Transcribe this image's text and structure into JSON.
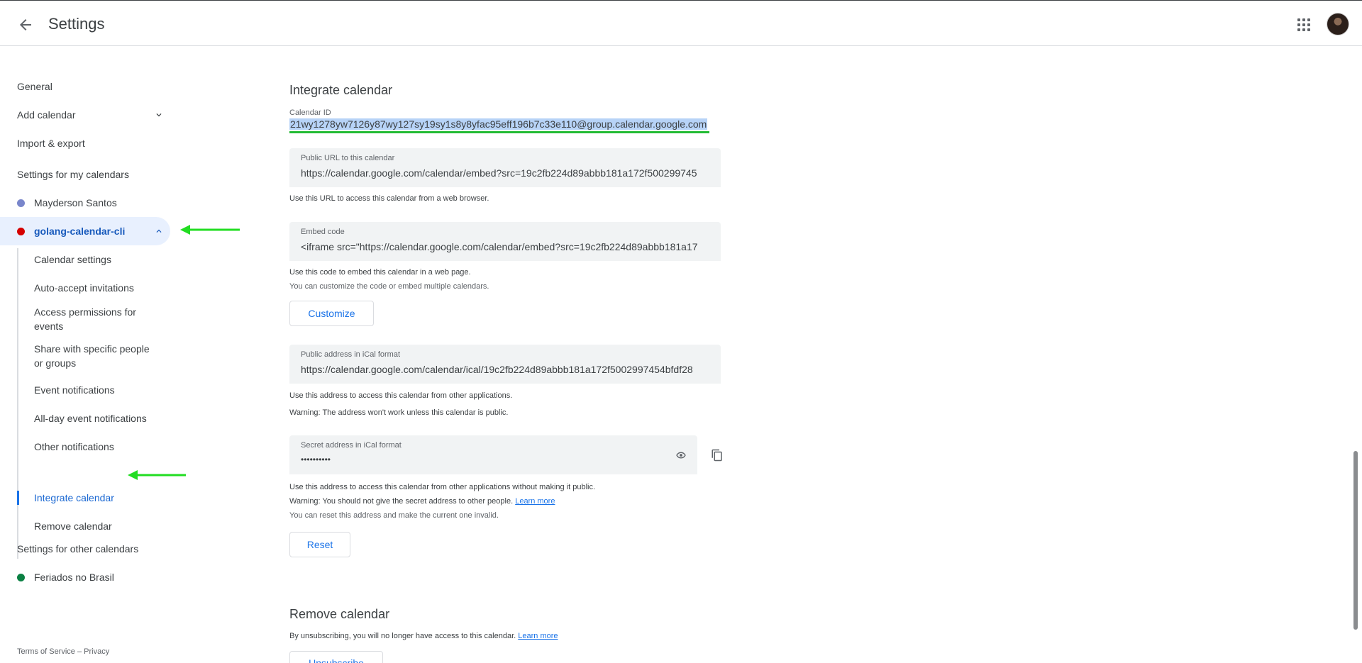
{
  "header": {
    "title": "Settings",
    "back_icon": "arrow-back-icon",
    "apps_icon": "apps-grid-icon"
  },
  "sidebar": {
    "top_items": [
      {
        "label": "General"
      },
      {
        "label": "Add calendar"
      },
      {
        "label": "Import & export"
      }
    ],
    "my_calendars_title": "Settings for my calendars",
    "my_calendars": [
      {
        "label": "Mayderson Santos",
        "color": "#7986cb"
      },
      {
        "label": "golang-calendar-cli",
        "color": "#d50000"
      }
    ],
    "sub_items": [
      {
        "label": "Calendar settings"
      },
      {
        "label": "Auto-accept invitations"
      },
      {
        "label": "Access permissions for events"
      },
      {
        "label": "Share with specific people or groups"
      },
      {
        "label": "Event notifications"
      },
      {
        "label": "All-day event notifications"
      },
      {
        "label": "Other notifications"
      },
      {
        "label": "Integrate calendar"
      },
      {
        "label": "Remove calendar"
      }
    ],
    "other_calendars_title": "Settings for other calendars",
    "other_calendars": [
      {
        "label": "Feriados no Brasil",
        "color": "#0b8043"
      }
    ],
    "footer": {
      "terms": "Terms of Service",
      "sep": " – ",
      "privacy": "Privacy"
    }
  },
  "integrate": {
    "title": "Integrate calendar",
    "calendar_id_label": "Calendar ID",
    "calendar_id": "21wy1278yw7126y87wy127sy19sy1s8y8yfac95eff196b7c33e110@group.calendar.google.com",
    "public_url": {
      "label": "Public URL to this calendar",
      "value": "https://calendar.google.com/calendar/embed?src=19c2fb224d89abbb181a172f500299745",
      "help": "Use this URL to access this calendar from a web browser."
    },
    "embed_code": {
      "label": "Embed code",
      "value": "<iframe src=\"https://calendar.google.com/calendar/embed?src=19c2fb224d89abbb181a17",
      "help1": "Use this code to embed this calendar in a web page.",
      "help2": "You can customize the code or embed multiple calendars."
    },
    "customize_button": "Customize",
    "public_ical": {
      "label": "Public address in iCal format",
      "value": "https://calendar.google.com/calendar/ical/19c2fb224d89abbb181a172f5002997454bfdf28",
      "help1": "Use this address to access this calendar from other applications.",
      "help2": "Warning: The address won't work unless this calendar is public."
    },
    "secret_ical": {
      "label": "Secret address in iCal format",
      "value": "••••••••••",
      "help1": "Use this address to access this calendar from other applications without making it public.",
      "help2": "Warning: You should not give the secret address to other people.",
      "learn_more": "Learn more",
      "help3": "You can reset this address and make the current one invalid."
    },
    "reset_button": "Reset"
  },
  "remove": {
    "title": "Remove calendar",
    "help": "By unsubscribing, you will no longer have access to this calendar.",
    "learn_more": "Learn more",
    "unsubscribe_button": "Unsubscribe"
  },
  "annotation_color": "#22dd22"
}
